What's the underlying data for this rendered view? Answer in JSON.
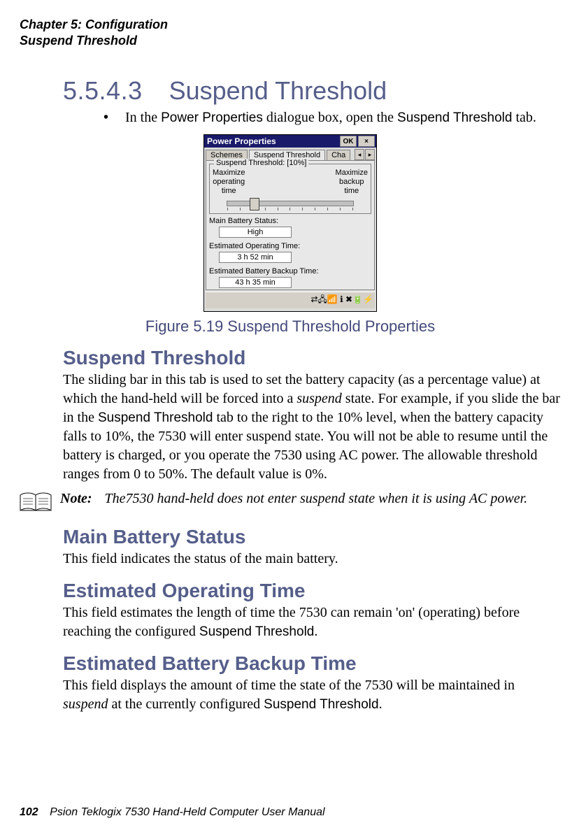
{
  "header": {
    "chapter_line": "Chapter 5: Configuration",
    "section_line": "Suspend Threshold"
  },
  "section": {
    "number": "5.5.4.3",
    "title": "Suspend Threshold"
  },
  "bullet": {
    "pre": "In the ",
    "ui1": "Power Properties",
    "mid": " dialogue box, open the ",
    "ui2": "Suspend Threshold",
    "post": " tab."
  },
  "dialog": {
    "title": "Power Properties",
    "ok": "OK",
    "close": "×",
    "tabs": {
      "schemes": "Schemes",
      "suspend": "Suspend Threshold",
      "cut": "Cha"
    },
    "arrows": {
      "left": "◂",
      "right": "▸"
    },
    "group_legend": "Suspend Threshold: [10%]",
    "left_label_1": "Maximize",
    "left_label_2": "operating",
    "left_label_3": "time",
    "right_label_1": "Maximize",
    "right_label_2": "backup",
    "right_label_3": "time",
    "main_status_lbl": "Main Battery Status:",
    "main_status_val": "High",
    "est_op_lbl": "Estimated Operating Time:",
    "est_op_val": "3 h 52 min",
    "est_backup_lbl": "Estimated Battery Backup Time:",
    "est_backup_val": "43 h 35 min",
    "tray_glyphs": "⇄🖧📶 ℹ ✖🔋⚡"
  },
  "figure_caption": "Figure 5.19 Suspend Threshold Properties",
  "subsections": {
    "st": {
      "title": "Suspend Threshold",
      "p_a": "The sliding bar in this tab is used to set the battery capacity (as a percentage value) at which the hand-held will be forced into a ",
      "p_b": "suspend",
      "p_c": " state. For example, if you slide the bar in the ",
      "p_d": "Suspend Threshold",
      "p_e": " tab to the right to the 10% level, when the battery capacity falls to 10%, the 7530 will enter suspend state. You will not be able to resume until the battery is charged, or you operate the 7530 using AC power. The allowable threshold ranges from 0 to 50%. The default value is 0%."
    },
    "note": {
      "lead": "Note:",
      "text": "The7530 hand-held does not enter suspend state when it is using AC power."
    },
    "mbs": {
      "title": "Main Battery Status",
      "p": "This field indicates the status of the main battery."
    },
    "eot": {
      "title": "Estimated Operating Time",
      "p_a": "This field estimates the length of time the 7530 can remain 'on' (operating) before reaching the configured ",
      "p_b": "Suspend Threshold",
      "p_c": "."
    },
    "ebbt": {
      "title": "Estimated Battery Backup Time",
      "p_a": "This field displays the amount of time the state of the 7530 will be maintained in ",
      "p_b": "suspend",
      "p_c": " at the currently configured ",
      "p_d": "Suspend Threshold",
      "p_e": "."
    }
  },
  "footer": {
    "page": "102",
    "book": "Psion Teklogix 7530 Hand-Held Computer User Manual"
  }
}
